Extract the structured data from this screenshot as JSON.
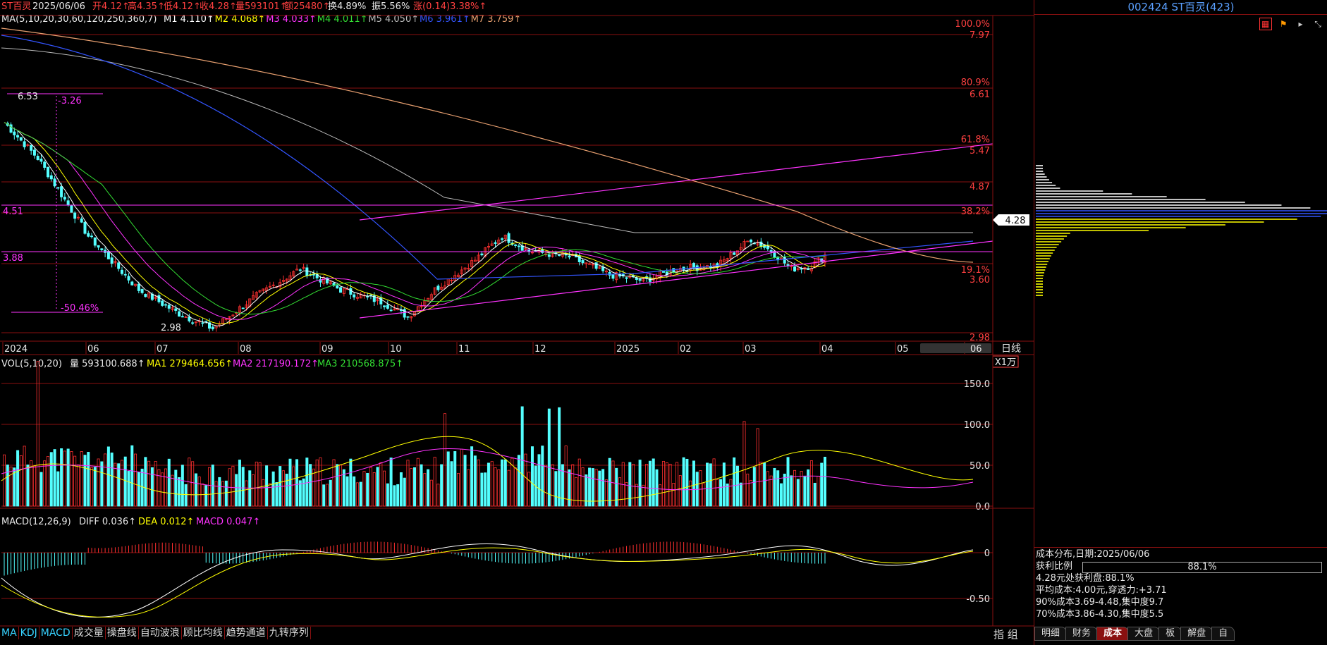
{
  "stock": {
    "name": "ST百灵",
    "date": "2025/06/06",
    "open": "开4.12↑",
    "high": "高4.35↑",
    "low": "低4.12↑",
    "close": "收4.28↑",
    "vol": "量593101↑",
    "amount": "额25480↑",
    "turnover": "换4.89%",
    "amplitude": "振5.56%",
    "change": "涨(0.14)3.38%↑"
  },
  "ma_line": {
    "label": "MA(5,10,20,30,60,120,250,360,7)",
    "items": [
      {
        "text": "M1 4.110↑",
        "color": "#ffffff"
      },
      {
        "text": "M2 4.068↑",
        "color": "#ffff00"
      },
      {
        "text": "M3 4.033↑",
        "color": "#ff33ff"
      },
      {
        "text": "M4 4.011↑",
        "color": "#33dd33"
      },
      {
        "text": "M5 4.050↑",
        "color": "#bbbbbb"
      },
      {
        "text": "M6 3.961↑",
        "color": "#3355ff"
      },
      {
        "text": "M7 3.759↑",
        "color": "#e8a070"
      }
    ]
  },
  "price_axis": {
    "labels": [
      {
        "price": "100.0%",
        "color": "#ff4040"
      },
      {
        "price": "7.97",
        "color": "#ff4040"
      },
      {
        "price": "80.9%",
        "color": "#ff4040"
      },
      {
        "price": "6.61",
        "color": "#ff4040"
      },
      {
        "price": "61.8%",
        "color": "#ff4040"
      },
      {
        "price": "5.47",
        "color": "#ff4040"
      },
      {
        "price": "4.87",
        "color": "#ff4040"
      },
      {
        "price": "38.2%",
        "color": "#ff4040"
      },
      {
        "price": "19.1%",
        "color": "#ff4040"
      },
      {
        "price": "3.60",
        "color": "#ff4040"
      },
      {
        "price": "2.98",
        "color": "#ff4040"
      }
    ],
    "current_price": "4.28"
  },
  "chart_annotations": {
    "top_left_price": "6.53",
    "top_left_change": "-3.26",
    "left_level_high": "4.51",
    "left_level_low": "3.88",
    "low_change": "-50.46%",
    "low_price": "2.98"
  },
  "date_axis": {
    "labels": [
      "2024",
      "06",
      "07",
      "08",
      "09",
      "10",
      "11",
      "12",
      "2025",
      "02",
      "03",
      "04",
      "05",
      "06"
    ],
    "period": "日线"
  },
  "volume": {
    "label": "VOL(5,10,20)",
    "vol": "量 593100.688↑",
    "ma1": "MA1 279464.656↑",
    "ma2": "MA2 217190.172↑",
    "ma3": "MA3 210568.875↑",
    "unit": "X1万",
    "axis": [
      "150.0",
      "100.0",
      "50.0",
      "0.0"
    ]
  },
  "macd": {
    "label": "MACD(12,26,9)",
    "diff": "DIFF 0.036↑",
    "dea": "DEA 0.012↑",
    "macd": "MACD 0.047↑",
    "axis": [
      "0",
      "-0.50"
    ]
  },
  "bottom_tabs": [
    "MA",
    "KDJ",
    "MACD",
    "成交量",
    "操盘线",
    "自动波浪",
    "顾比均线",
    "趋势通道",
    "九转序列"
  ],
  "bottom_right": "指 组",
  "right_panel": {
    "title": "002424 ST百灵(423)",
    "cost_header": "成本分布,日期:2025/06/06",
    "profit_label": "获利比例",
    "profit_value": "88.1%",
    "profit_ratio": 0.881,
    "line1": "4.28元处获利盘:88.1%",
    "line2": "平均成本:4.00元,穿透力:+3.71",
    "line3": "90%成本3.69-4.48,集中度9.7",
    "line4": "70%成本3.86-4.30,集中度5.5",
    "tabs": [
      "明细",
      "财务",
      "成本",
      "大盘",
      "板",
      "解盘",
      "自"
    ]
  },
  "colors": {
    "up": "#ff3030",
    "down": "#54ffff",
    "grid": "#8a1010",
    "accent": "#ff33ff"
  }
}
